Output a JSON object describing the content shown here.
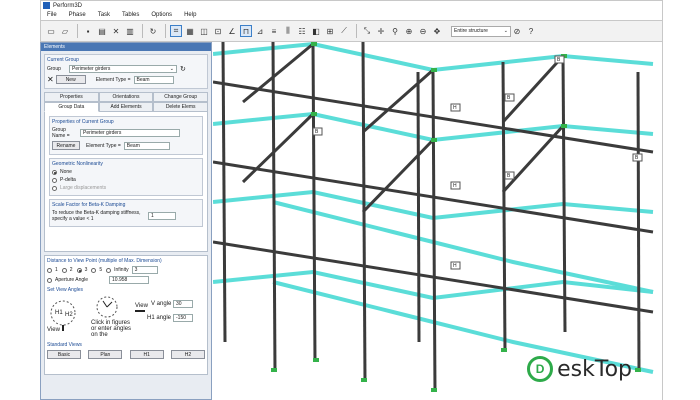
{
  "app": {
    "title": "Perform3D"
  },
  "menu": [
    "File",
    "Phase",
    "Task",
    "Tables",
    "Options",
    "Help"
  ],
  "toolbar": {
    "structure_select": "Entire structure"
  },
  "panel": {
    "title": "Elements",
    "current_group": {
      "title": "Current Group",
      "group_label": "Group",
      "group_value": "Perimeter girders",
      "new_button": "New",
      "element_type_label": "Element Type =",
      "element_type_value": "Beam"
    },
    "tabs_row1": [
      "Properties",
      "Orientations",
      "Change Group"
    ],
    "tabs_row2": [
      "Group Data",
      "Add Elements",
      "Delete Elems"
    ],
    "properties": {
      "title": "Properties of Current Group",
      "group_name_label": "Group Name =",
      "group_name_value": "Perimeter girders",
      "rename_button": "Rename",
      "element_type_label": "Element Type =",
      "element_type_value": "Beam"
    },
    "nonlinearity": {
      "title": "Geometric Nonlinearity",
      "options": [
        "None",
        "P-delta",
        "Large displacements"
      ]
    },
    "damping": {
      "title": "Scale Factor for Beta-K Damping",
      "desc": "To reduce the Beta-K damping stiffness, specify a value < 1",
      "value": "1"
    },
    "distance": {
      "title": "Distance to View Point (multiple of Max. Dimension)",
      "options": [
        "1",
        "2",
        "3",
        "5",
        "Infinity"
      ],
      "infinity_value": "3",
      "aperture_label": "Aperture Angle",
      "aperture_value": "10.958"
    },
    "angles": {
      "title": "Set View Angles",
      "view_label": "View",
      "h1": "H1",
      "h2": "H2",
      "view_arrow_label": "View",
      "v_angle_label": "V angle",
      "v_angle_value": "30",
      "h1_angle_label": "H1 angle",
      "h1_angle_value": "-150",
      "hint": "Click in figures or enter angles on the"
    },
    "standard_views": {
      "title": "Standard Views",
      "buttons": [
        "Basic",
        "Plan",
        "H1",
        "H2"
      ]
    }
  },
  "watermark": {
    "text": "eskTop",
    "logo_letter": "D"
  },
  "model_labels": [
    "H",
    "B",
    "B",
    "H",
    "B",
    "B",
    "H",
    "B"
  ],
  "colors": {
    "selected_frame": "#3fd8d2",
    "members": "#3b3b3b",
    "nodes": "#34b24a"
  }
}
